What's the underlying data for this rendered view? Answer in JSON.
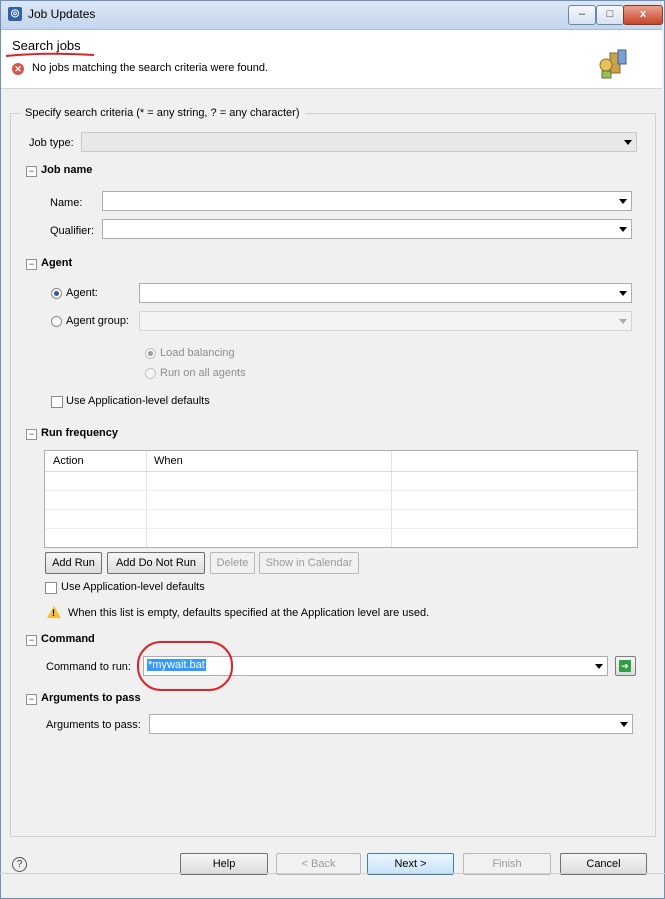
{
  "window": {
    "title": "Job Updates",
    "min_label": "–",
    "max_label": "□",
    "close_label": "x"
  },
  "header": {
    "title": "Search jobs",
    "message": "No jobs matching the search criteria were found."
  },
  "criteria": {
    "legend": "Specify search criteria (* = any string, ? = any character)",
    "job_type_label": "Job type:",
    "job_type_value": ""
  },
  "job_name": {
    "section_title": "Job name",
    "name_label": "Name:",
    "name_value": "",
    "qualifier_label": "Qualifier:",
    "qualifier_value": ""
  },
  "agent": {
    "section_title": "Agent",
    "agent_label": "Agent:",
    "agent_value": "",
    "agent_group_label": "Agent group:",
    "agent_group_value": "",
    "load_balancing_label": "Load balancing",
    "run_all_label": "Run on all agents",
    "app_defaults_label": "Use Application-level defaults",
    "selected": "agent"
  },
  "run_frequency": {
    "section_title": "Run frequency",
    "columns": [
      "Action",
      "When",
      ""
    ],
    "rows": [],
    "buttons": {
      "add_run": "Add Run",
      "add_do_not_run": "Add Do Not Run",
      "delete": "Delete",
      "show_calendar": "Show in Calendar"
    },
    "app_defaults_label": "Use Application-level defaults",
    "warning": "When this list is empty, defaults specified at the Application level are used."
  },
  "command": {
    "section_title": "Command",
    "label": "Command to run:",
    "value": "*mywait.bat"
  },
  "arguments": {
    "section_title": "Arguments to pass",
    "label": "Arguments to pass:",
    "value": ""
  },
  "footer": {
    "help": "Help",
    "back": "< Back",
    "next": "Next >",
    "finish": "Finish",
    "cancel": "Cancel"
  },
  "colors": {
    "error": "#d9534f",
    "annotation": "#d9262b",
    "selection": "#3399ff",
    "warning": "#f2c037"
  }
}
